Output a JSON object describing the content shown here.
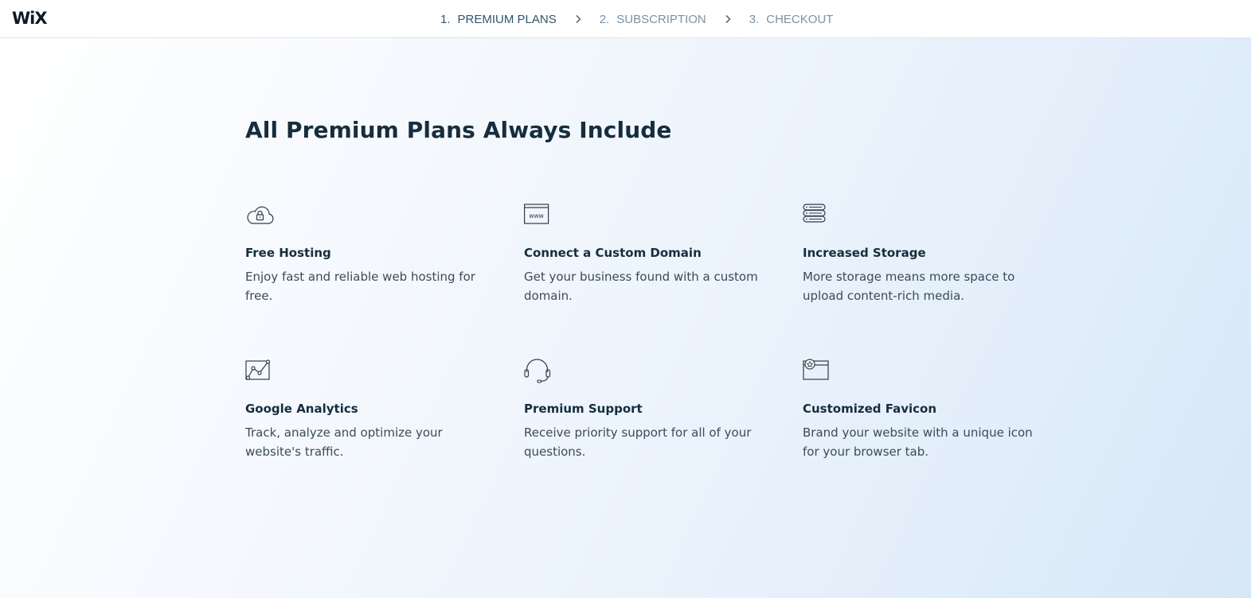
{
  "header": {
    "logo": "WiX",
    "steps": [
      {
        "number": "1.",
        "label": "PREMIUM PLANS",
        "state": "active"
      },
      {
        "number": "2.",
        "label": "SUBSCRIPTION",
        "state": "inactive"
      },
      {
        "number": "3.",
        "label": "CHECKOUT",
        "state": "inactive"
      }
    ]
  },
  "main": {
    "title": "All Premium Plans Always Include",
    "features": [
      {
        "icon": "cloud-lock-icon",
        "title": "Free Hosting",
        "description": "Enjoy fast and reliable web hosting for free."
      },
      {
        "icon": "www-browser-icon",
        "title": "Connect a Custom Domain",
        "description": "Get your business found with a custom domain."
      },
      {
        "icon": "storage-stack-icon",
        "title": "Increased Storage",
        "description": "More storage means more space to upload content-rich media."
      },
      {
        "icon": "analytics-chart-icon",
        "title": "Google Analytics",
        "description": "Track, analyze and optimize your website's traffic."
      },
      {
        "icon": "headset-icon",
        "title": "Premium Support",
        "description": "Receive priority support for all of your questions."
      },
      {
        "icon": "favicon-star-icon",
        "title": "Customized Favicon",
        "description": "Brand your website with a unique icon for your browser tab."
      }
    ]
  },
  "colors": {
    "text_dark": "#162d3d",
    "text_body": "#3b4b58",
    "step_active": "#32536a",
    "step_inactive": "#7a92a5",
    "background_start": "#ffffff",
    "background_end": "#d6e7f8"
  }
}
